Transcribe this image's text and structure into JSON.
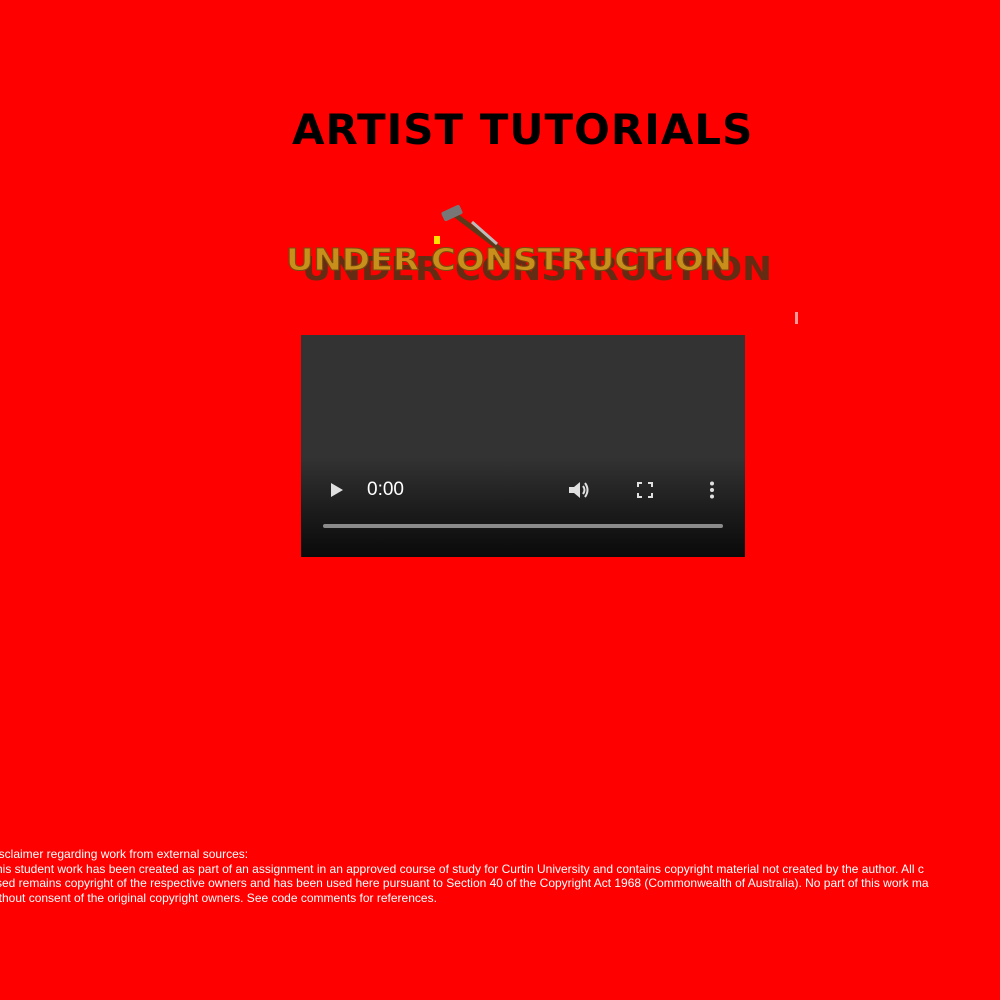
{
  "page": {
    "title": "ARTIST TUTORIALS",
    "background_color": "#ff0000"
  },
  "banner": {
    "text": "UNDER CONSTRUCTION",
    "icon": "hammer-icon",
    "text_color": "#c8901a"
  },
  "video_player": {
    "time": "0:00",
    "icons": [
      "play-icon",
      "volume-icon",
      "fullscreen-icon",
      "more-options-icon"
    ]
  },
  "disclaimer": {
    "heading": "isclaimer regarding work from external sources:",
    "lines": [
      "his student work has been created as part of an assignment in an approved course of study for Curtin University and contains copyright material not created by the author. All c",
      "sed remains copyright of the respective owners and has been used here pursuant to Section 40 of the Copyright Act 1968 (Commonwealth of Australia). No part of this work ma",
      "ithout consent of the original copyright owners. See code comments for references."
    ]
  }
}
